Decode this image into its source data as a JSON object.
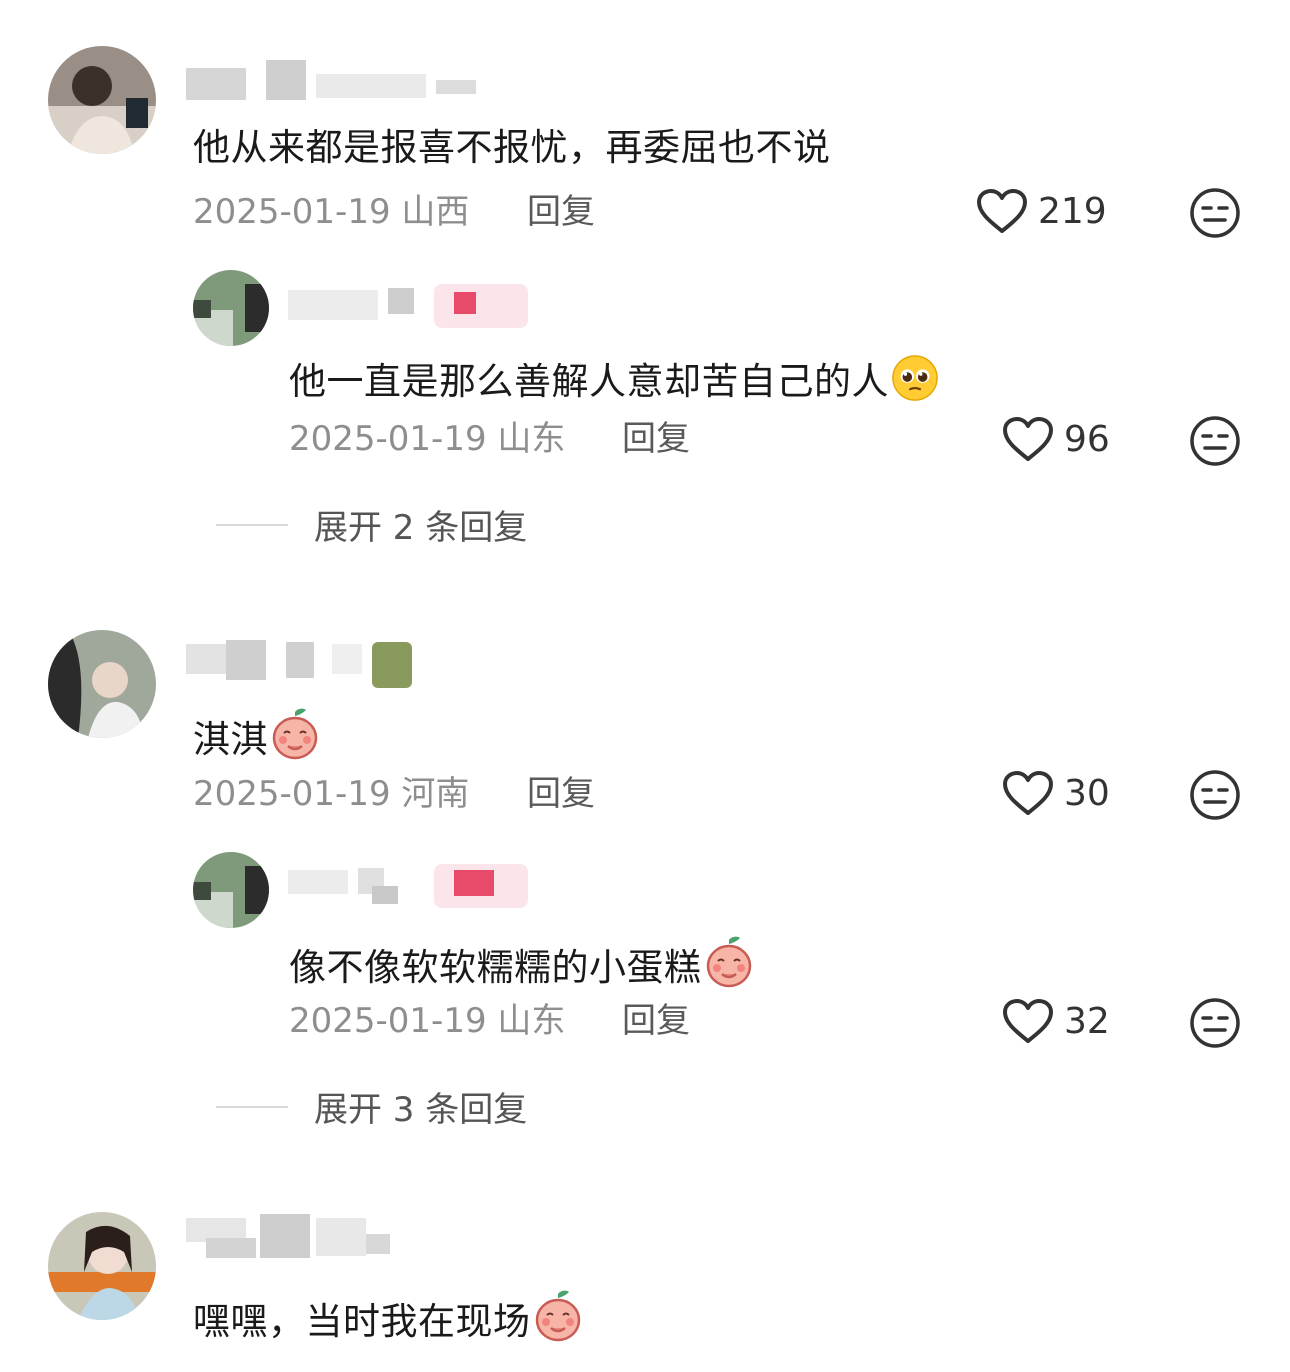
{
  "comments": [
    {
      "text": "他从来都是报喜不报忧，再委屈也不说",
      "date": "2025-01-19",
      "location": "山西",
      "reply_label": "回复",
      "likes": "219",
      "reply": {
        "text": "他一直是那么善解人意却苦自己的人",
        "emoji": "pleading-face-emoji",
        "date": "2025-01-19",
        "location": "山东",
        "reply_label": "回复",
        "likes": "96"
      },
      "expand_label": "展开 2 条回复"
    },
    {
      "text": "淇淇",
      "emoji": "peach-mascot-emoji",
      "date": "2025-01-19",
      "location": "河南",
      "reply_label": "回复",
      "likes": "30",
      "reply": {
        "text": "像不像软软糯糯的小蛋糕",
        "emoji": "peach-mascot-emoji",
        "date": "2025-01-19",
        "location": "山东",
        "reply_label": "回复",
        "likes": "32"
      },
      "expand_label": "展开 3 条回复"
    },
    {
      "text": "嘿嘿，当时我在现场",
      "emoji": "peach-mascot-emoji"
    }
  ],
  "colors": {
    "like_icon": "#333333",
    "meta_text": "#8e8e8e",
    "tag_pink": "#e84a6a"
  }
}
